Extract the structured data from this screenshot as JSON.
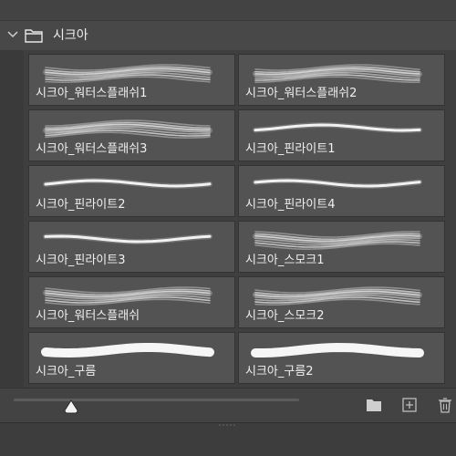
{
  "group": {
    "title": "시크아"
  },
  "brushes": [
    {
      "name": "시크아_워터스플래쉬1",
      "style": "splash"
    },
    {
      "name": "시크아_워터스플래쉬2",
      "style": "splash"
    },
    {
      "name": "시크아_워터스플래쉬3",
      "style": "splash"
    },
    {
      "name": "시크아_핀라이트1",
      "style": "thin"
    },
    {
      "name": "시크아_핀라이트2",
      "style": "thin"
    },
    {
      "name": "시크아_핀라이트4",
      "style": "thin"
    },
    {
      "name": "시크아_핀라이트3",
      "style": "thin"
    },
    {
      "name": "시크아_스모크1",
      "style": "smoke"
    },
    {
      "name": "시크아_워터스플래쉬",
      "style": "splash"
    },
    {
      "name": "시크아_스모크2",
      "style": "smoke"
    },
    {
      "name": "시크아_구름",
      "style": "cloud"
    },
    {
      "name": "시크아_구름2",
      "style": "cloud"
    }
  ],
  "size_slider": {
    "value_fraction": 0.2
  },
  "icons": {
    "expand": "chevron-down-icon",
    "group_folder": "folder-icon",
    "new_group": "folder-icon",
    "new_brush": "add-icon",
    "delete": "trash-icon"
  }
}
